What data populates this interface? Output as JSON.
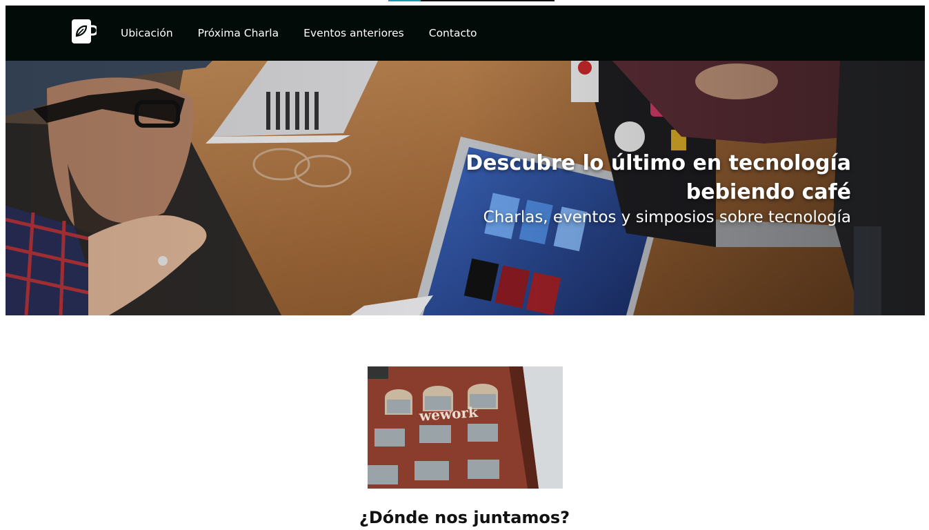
{
  "nav": {
    "logo_icon": "coffee-leaf-icon",
    "links": [
      {
        "label": "Ubicación"
      },
      {
        "label": "Próxima Charla"
      },
      {
        "label": "Eventos anteriores"
      },
      {
        "label": "Contacto"
      }
    ]
  },
  "hero": {
    "title": "Descubre lo último en tecnología bebiendo café",
    "subtitle": "Charlas, eventos y simposios sobre tecnología"
  },
  "location": {
    "building_sign": "wework",
    "heading": "¿Dónde nos juntamos?"
  },
  "colors": {
    "nav_bg": "#020b07",
    "accent": "#1a9cb0",
    "wood": "#a26a3a",
    "brick": "#8a3d2c"
  }
}
